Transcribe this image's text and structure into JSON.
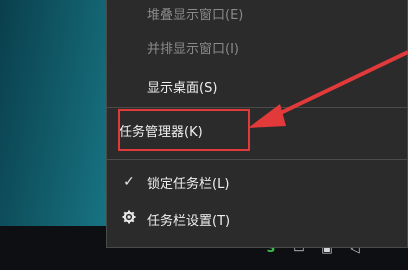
{
  "menu": {
    "cascade": "堆叠显示窗口(E)",
    "side_by_side": "并排显示窗口(I)",
    "show_desktop": "显示桌面(S)",
    "task_manager": "任务管理器(K)",
    "lock_taskbar": "锁定任务栏(L)",
    "taskbar_settings": "任务栏设置(T)"
  },
  "colors": {
    "annotation": "#e23a3a",
    "menu_bg": "#2b2b2b",
    "taskbar_bg": "#0d0f12"
  },
  "icons": {
    "lock_check": "checkmark-icon",
    "settings": "gear-icon"
  }
}
